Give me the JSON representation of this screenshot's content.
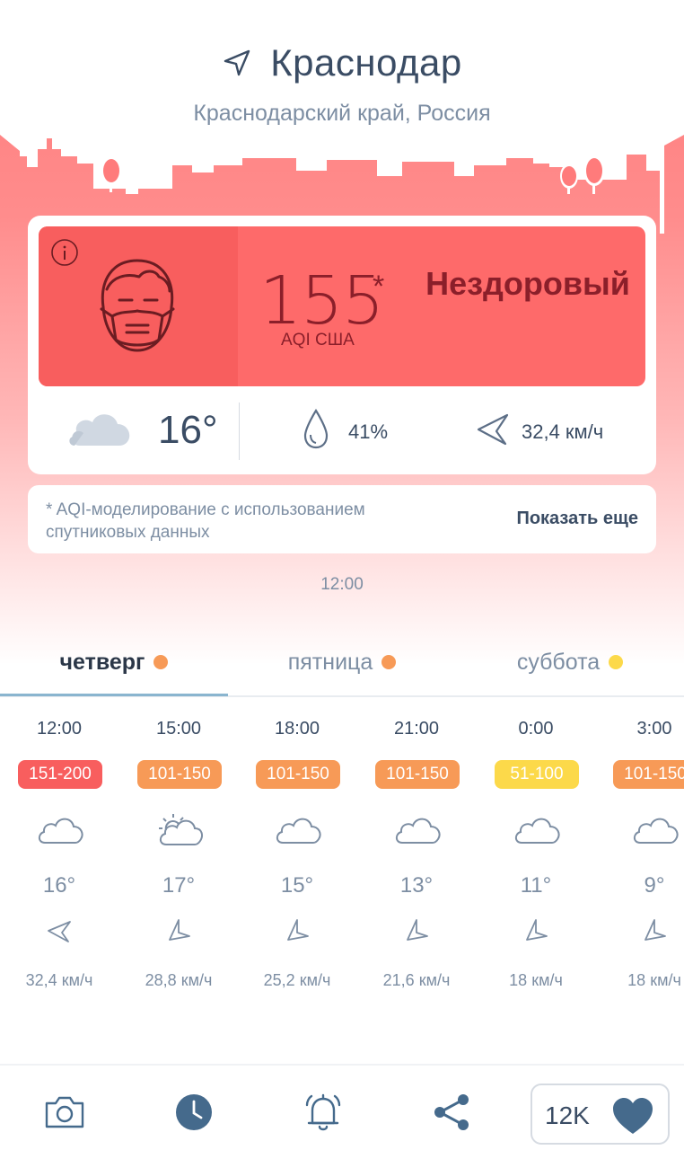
{
  "location": {
    "city": "Краснодар",
    "region": "Краснодарский край, Россия"
  },
  "aqi": {
    "value": "155",
    "asterisk": "*",
    "unit": "AQI США",
    "status": "Нездоровый",
    "color": "#fe6a6a"
  },
  "current_weather": {
    "temperature": "16°",
    "humidity": "41%",
    "wind": "32,4 км/ч",
    "icons": [
      "cloud-icon",
      "drop-icon",
      "wind-arrow-icon"
    ]
  },
  "note": {
    "text": "* AQI-моделирование с использованием спутниковых данных",
    "show_more": "Показать еще"
  },
  "updated_time": "12:00",
  "tabs": [
    {
      "label": "четверг",
      "dot_color": "#f79a57",
      "active": true
    },
    {
      "label": "пятница",
      "dot_color": "#f79a57",
      "active": false
    },
    {
      "label": "суббота",
      "dot_color": "#fcd94a",
      "active": false
    }
  ],
  "forecast": [
    {
      "time": "12:00",
      "aqi": "151-200",
      "color": "#f85e5e",
      "icon": "cloud-icon",
      "temp": "16°",
      "wind": "32,4 км/ч"
    },
    {
      "time": "15:00",
      "aqi": "101-150",
      "color": "#f79a57",
      "icon": "sun-cloud-icon",
      "temp": "17°",
      "wind": "28,8 км/ч"
    },
    {
      "time": "18:00",
      "aqi": "101-150",
      "color": "#f79a57",
      "icon": "cloud-icon",
      "temp": "15°",
      "wind": "25,2 км/ч"
    },
    {
      "time": "21:00",
      "aqi": "101-150",
      "color": "#f79a57",
      "icon": "cloud-icon",
      "temp": "13°",
      "wind": "21,6 км/ч"
    },
    {
      "time": "0:00",
      "aqi": "51-100",
      "color": "#fcd94a",
      "icon": "cloud-icon",
      "temp": "11°",
      "wind": "18 км/ч"
    },
    {
      "time": "3:00",
      "aqi": "101-150",
      "color": "#f79a57",
      "icon": "cloud-icon",
      "temp": "9°",
      "wind": "18 км/ч"
    }
  ],
  "bottom_bar": {
    "likes": "12K",
    "icons": [
      "camera-icon",
      "clock-icon",
      "bell-icon",
      "share-icon",
      "heart-icon"
    ]
  }
}
